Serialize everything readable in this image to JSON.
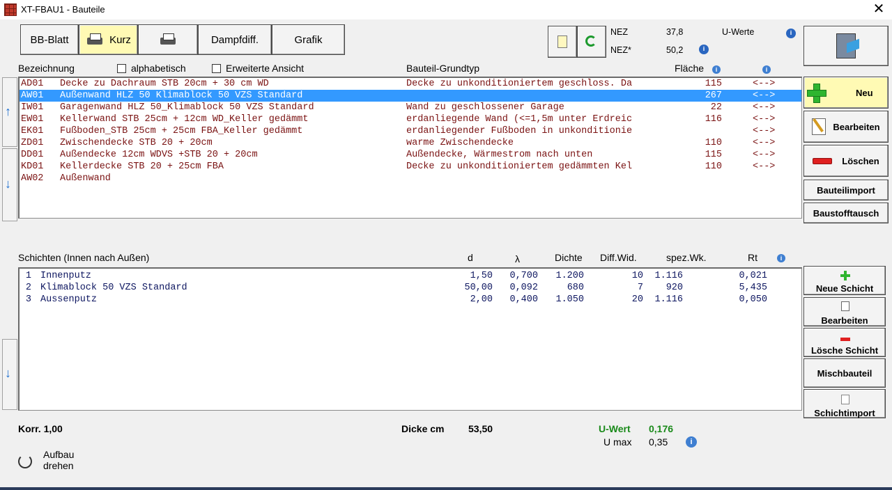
{
  "window": {
    "title": "XT-FBAU1 - Bauteile",
    "close_glyph": "✕"
  },
  "toolbar": {
    "bb_blatt": "BB-Blatt",
    "kurz": "Kurz",
    "dampfdiff": "Dampfdiff.",
    "grafik": "Grafik"
  },
  "nez": {
    "nez_label": "NEZ",
    "nez_value": "37,8",
    "nez_star_label": "NEZ*",
    "nez_star_value": "50,2",
    "uwerte_label": "U-Werte"
  },
  "bauteile_header": {
    "bezeichnung": "Bezeichnung",
    "alphabetisch": "alphabetisch",
    "erweiterte": "Erweiterte Ansicht",
    "grundtyp": "Bauteil-Grundtyp",
    "flaeche": "Fläche"
  },
  "bauteile": [
    {
      "code": "AD01",
      "name": "Decke zu Dachraum STB 20cm + 30 cm WD",
      "typ": "Decke zu unkonditioniertem geschloss. Da",
      "flaeche": "115",
      "arrow": "<-->"
    },
    {
      "code": "AW01",
      "name": "Außenwand HLZ 50 Klimablock 50 VZS Standard",
      "typ": "",
      "flaeche": "267",
      "arrow": "<-->",
      "selected": true
    },
    {
      "code": "IW01",
      "name": "Garagenwand HLZ 50_Klimablock 50 VZS Standard",
      "typ": "Wand zu geschlossener Garage",
      "flaeche": "22",
      "arrow": "<-->"
    },
    {
      "code": "EW01",
      "name": "Kellerwand STB 25cm + 12cm WD_Keller gedämmt",
      "typ": "erdanliegende Wand (<=1,5m unter Erdreic",
      "flaeche": "116",
      "arrow": "<-->"
    },
    {
      "code": "EK01",
      "name": "Fußboden_STB 25cm + 25cm FBA_Keller gedämmt",
      "typ": "erdanliegender Fußboden in unkonditionie",
      "flaeche": "",
      "arrow": "<-->"
    },
    {
      "code": "ZD01",
      "name": "Zwischendecke STB 20 + 20cm",
      "typ": "warme Zwischendecke",
      "flaeche": "110",
      "arrow": "<-->"
    },
    {
      "code": "DD01",
      "name": "Außendecke 12cm WDVS +STB 20 + 20cm",
      "typ": "Außendecke, Wärmestrom nach unten",
      "flaeche": "115",
      "arrow": "<-->"
    },
    {
      "code": "KD01",
      "name": "Kellerdecke STB 20 + 25cm FBA",
      "typ": "Decke zu unkonditioniertem gedämmten Kel",
      "flaeche": "110",
      "arrow": "<-->"
    },
    {
      "code": "AW02",
      "name": "Außenwand",
      "typ": "",
      "flaeche": "",
      "arrow": ""
    }
  ],
  "right_buttons": {
    "neu": "Neu",
    "bearbeiten": "Bearbeiten",
    "loeschen": "Löschen",
    "bauteilimport": "Bauteilimport",
    "baustofftausch": "Baustofftausch"
  },
  "schichten_header": {
    "title": "Schichten (Innen nach Außen)",
    "d": "d",
    "lambda": "λ",
    "dichte": "Dichte",
    "diffwid": "Diff.Wid.",
    "spezwk": "spez.Wk.",
    "rt": "Rt"
  },
  "schichten": [
    {
      "nr": "1",
      "name": "Innenputz",
      "d": "1,50",
      "lambda": "0,700",
      "dichte": "1.200",
      "diffwid": "10",
      "spezwk": "1.116",
      "rt": "0,021"
    },
    {
      "nr": "2",
      "name": "Klimablock 50 VZS Standard",
      "d": "50,00",
      "lambda": "0,092",
      "dichte": "680",
      "diffwid": "7",
      "spezwk": "920",
      "rt": "5,435"
    },
    {
      "nr": "3",
      "name": "Aussenputz",
      "d": "2,00",
      "lambda": "0,400",
      "dichte": "1.050",
      "diffwid": "20",
      "spezwk": "1.116",
      "rt": "0,050"
    }
  ],
  "schicht_buttons": {
    "neue": "Neue Schicht",
    "bearbeiten": "Bearbeiten",
    "loesche": "Lösche Schicht",
    "misch": "Mischbauteil",
    "import": "Schichtimport"
  },
  "footer": {
    "korr": "Korr. 1,00",
    "dicke_label": "Dicke cm",
    "dicke_value": "53,50",
    "uwert_label": "U-Wert",
    "uwert_value": "0,176",
    "umax_label": "U max",
    "umax_value": "0,35",
    "aufbau_line1": "Aufbau",
    "aufbau_line2": "drehen"
  },
  "colors": {
    "selection": "#3399ff",
    "list_text": "#7a1212",
    "layer_text": "#0d1660",
    "uwert": "#1a8a1a",
    "accent_yellow": "#fffab4"
  }
}
